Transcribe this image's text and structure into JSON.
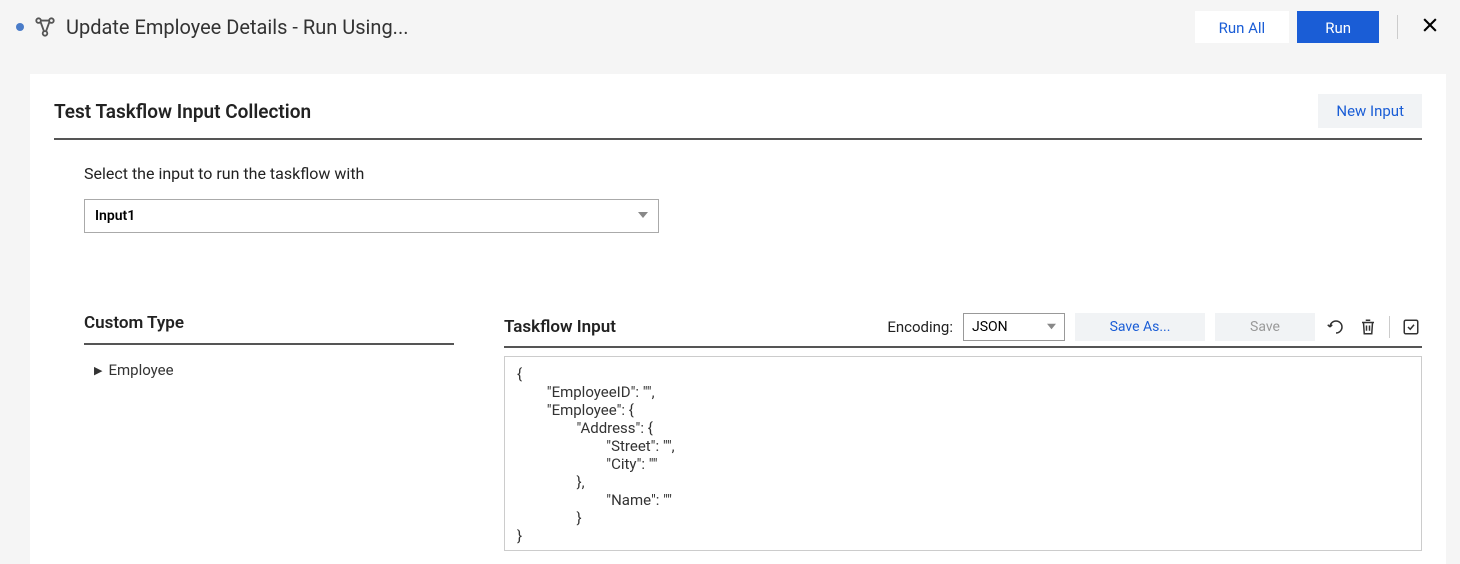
{
  "header": {
    "title": "Update Employee Details - Run Using...",
    "run_all": "Run All",
    "run": "Run"
  },
  "panel": {
    "title": "Test Taskflow Input Collection",
    "new_input": "New Input",
    "select_label": "Select the input to run the taskflow with",
    "selected_input": "Input1"
  },
  "custom_type": {
    "title": "Custom Type",
    "items": [
      "Employee"
    ]
  },
  "taskflow_input": {
    "title": "Taskflow Input",
    "encoding_label": "Encoding:",
    "encoding_value": "JSON",
    "save_as": "Save As...",
    "save": "Save",
    "code_lines": [
      "{",
      "        \"EmployeeID\": \"\",",
      "        \"Employee\": {",
      "                \"Address\": {",
      "                        \"Street\": \"\",",
      "                        \"City\": \"\"",
      "                },",
      "                        \"Name\": \"\"",
      "                }",
      "}"
    ]
  }
}
